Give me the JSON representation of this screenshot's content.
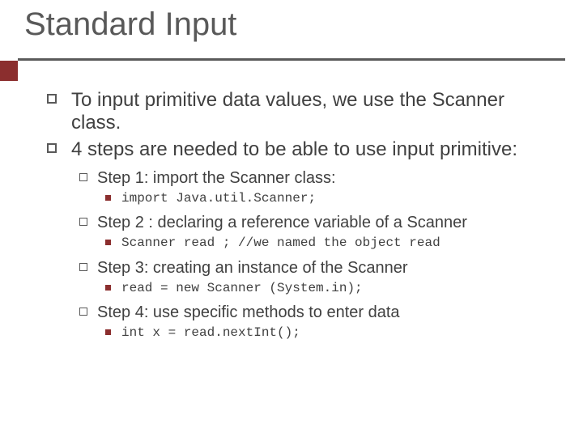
{
  "title": "Standard Input",
  "bullets": {
    "p1": "To input primitive data values, we use the Scanner class.",
    "p2": "4 steps are needed to be able to use input primitive:",
    "step1": {
      "label": "Step 1:  import the Scanner class:",
      "code": "import Java.util.Scanner;"
    },
    "step2": {
      "label": "Step 2 : declaring a reference variable of a Scanner",
      "code": "Scanner read ;   //we named the object read"
    },
    "step3": {
      "label": "Step 3: creating an instance of the Scanner",
      "code": "read = new Scanner (System.in);"
    },
    "step4": {
      "label": "Step 4: use specific methods to enter data",
      "code": "int x = read.nextInt();"
    }
  }
}
